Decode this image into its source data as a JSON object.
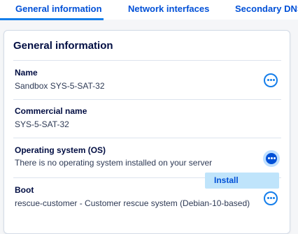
{
  "tabs": [
    {
      "label": "General information"
    },
    {
      "label": "Network interfaces"
    },
    {
      "label": "Secondary DNS"
    }
  ],
  "card": {
    "title": "General information",
    "rows": [
      {
        "label": "Name",
        "value": "Sandbox SYS-5-SAT-32",
        "has_menu": true
      },
      {
        "label": "Commercial name",
        "value": "SYS-5-SAT-32",
        "has_menu": false
      },
      {
        "label": "Operating system (OS)",
        "value": "There is no operating system installed on your server",
        "has_menu": true,
        "menu_open": true
      },
      {
        "label": "Boot",
        "value": "rescue-customer - Customer rescue system (Debian-10-based)",
        "has_menu": true
      }
    ]
  },
  "os_menu": {
    "items": [
      {
        "label": "Install"
      }
    ]
  },
  "colors": {
    "accent": "#157eea",
    "brand_dark": "#000d42",
    "link": "#0050d7",
    "menu_bg": "#bfe4fb"
  }
}
